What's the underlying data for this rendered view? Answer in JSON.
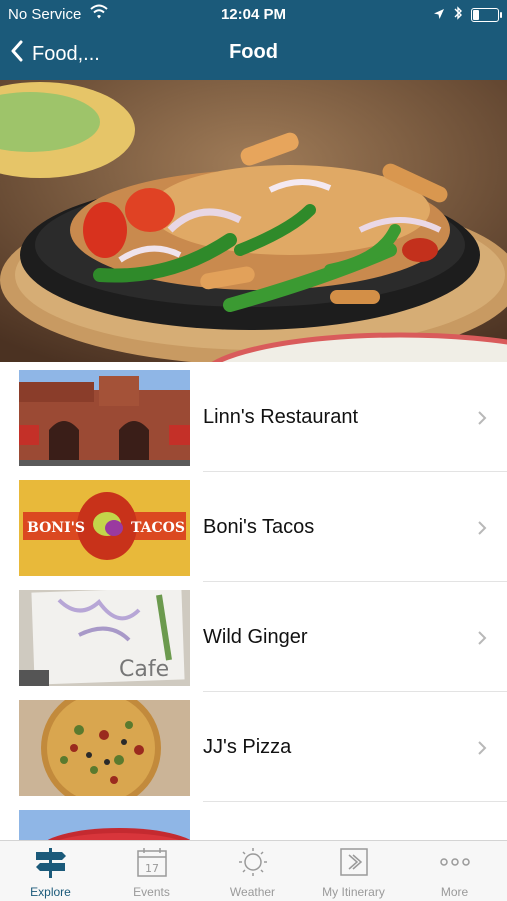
{
  "status_bar": {
    "carrier": "No Service",
    "time": "12:04 PM",
    "battery_level": 0.25
  },
  "nav": {
    "back_label": "Food,...",
    "title": "Food"
  },
  "list": {
    "items": [
      {
        "name": "Linn's Restaurant"
      },
      {
        "name": "Boni's Tacos",
        "logo_left": "BONI'S",
        "logo_right": "TACOS"
      },
      {
        "name": "Wild Ginger",
        "sign_text": "Cafe"
      },
      {
        "name": "JJ's Pizza"
      }
    ]
  },
  "tabbar": {
    "active": "Explore",
    "tabs": [
      {
        "label": "Explore",
        "icon": "signpost-icon"
      },
      {
        "label": "Events",
        "icon": "calendar-icon",
        "badge": "17"
      },
      {
        "label": "Weather",
        "icon": "sun-icon"
      },
      {
        "label": "My Itinerary",
        "icon": "itinerary-icon"
      },
      {
        "label": "More",
        "icon": "more-icon"
      }
    ]
  },
  "colors": {
    "brand": "#1b5a7a",
    "tab_inactive": "#9a9a9a",
    "chevron": "#b8b8b8"
  }
}
